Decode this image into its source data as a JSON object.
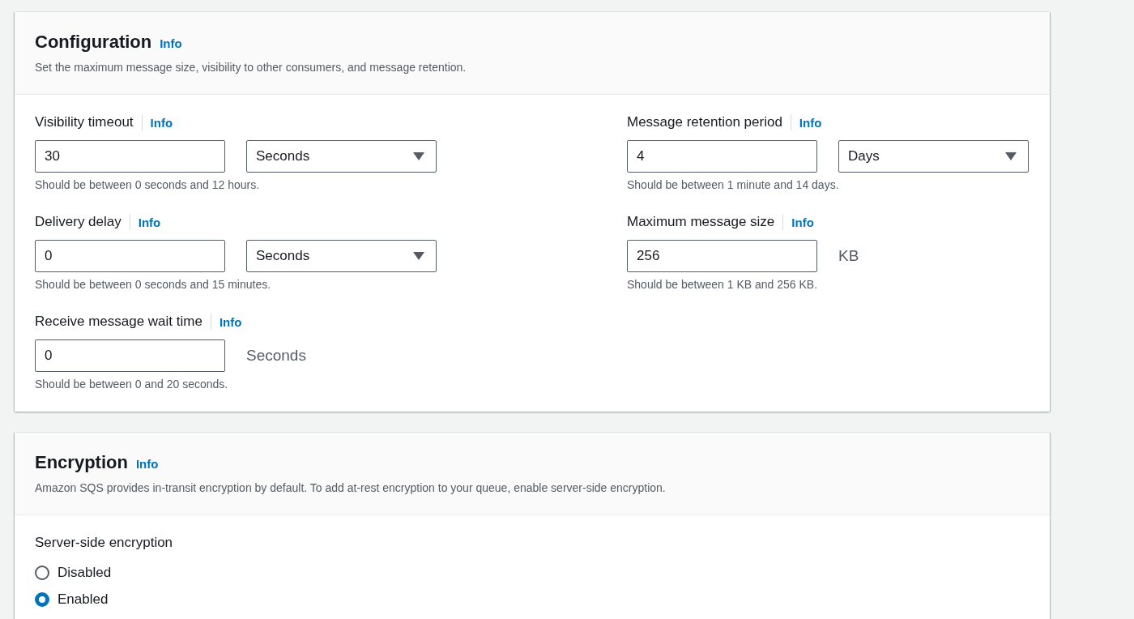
{
  "configuration": {
    "title": "Configuration",
    "info": "Info",
    "description": "Set the maximum message size, visibility to other consumers, and message retention.",
    "columns": [
      [
        {
          "label": "Visibility timeout",
          "info": "Info",
          "value": "30",
          "kind": "select",
          "unit": "Seconds",
          "hint": "Should be between 0 seconds and 12 hours."
        },
        {
          "label": "Delivery delay",
          "info": "Info",
          "value": "0",
          "kind": "select",
          "unit": "Seconds",
          "hint": "Should be between 0 seconds and 15 minutes."
        },
        {
          "label": "Receive message wait time",
          "info": "Info",
          "value": "0",
          "kind": "unit",
          "unit": "Seconds",
          "hint": "Should be between 0 and 20 seconds."
        }
      ],
      [
        {
          "label": "Message retention period",
          "info": "Info",
          "value": "4",
          "kind": "select",
          "unit": "Days",
          "hint": "Should be between 1 minute and 14 days."
        },
        {
          "label": "Maximum message size",
          "info": "Info",
          "value": "256",
          "kind": "unit",
          "unit": "KB",
          "hint": "Should be between 1 KB and 256 KB."
        }
      ]
    ]
  },
  "encryption": {
    "title": "Encryption",
    "info": "Info",
    "description": "Amazon SQS provides in-transit encryption by default. To add at-rest encryption to your queue, enable server-side encryption.",
    "server_side": {
      "label": "Server-side encryption",
      "options": [
        {
          "label": "Disabled",
          "selected": false
        },
        {
          "label": "Enabled",
          "selected": true
        }
      ]
    }
  }
}
